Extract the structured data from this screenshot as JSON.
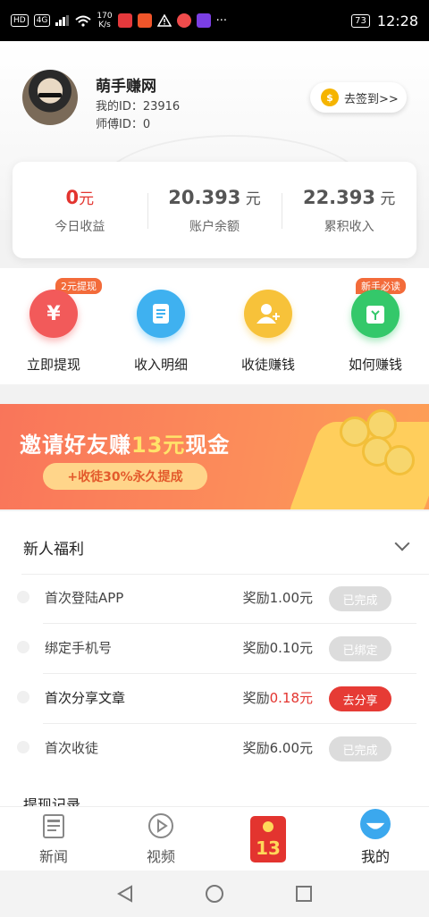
{
  "status_bar": {
    "network_hd": "HD",
    "network_4g": "4G",
    "speed_value": "170",
    "speed_unit": "K/s",
    "more": "···",
    "battery": "73",
    "time": "12:28"
  },
  "profile": {
    "name": "萌手赚网",
    "my_id": "我的ID：23916",
    "master_id": "师傅ID：0",
    "checkin_label": "去签到>>"
  },
  "stats": [
    {
      "value": "0",
      "unit": "元",
      "label": "今日收益"
    },
    {
      "value": "20.393",
      "unit": " 元",
      "label": "账户余额"
    },
    {
      "value": "22.393",
      "unit": " 元",
      "label": "累积收入"
    }
  ],
  "actions": [
    {
      "label": "立即提现",
      "tag": "2元提现",
      "color": "#f25a5a"
    },
    {
      "label": "收入明细",
      "tag": "",
      "color": "#3fb1f0"
    },
    {
      "label": "收徒赚钱",
      "tag": "",
      "color": "#f7c23a"
    },
    {
      "label": "如何赚钱",
      "tag": "新手必读",
      "color": "#34c86a"
    }
  ],
  "banner": {
    "title_pre": "邀请好友赚",
    "title_hl": "13元",
    "title_post": "现金",
    "pill": "+收徒30%永久提成"
  },
  "welfare": {
    "title": "新人福利",
    "rows": [
      {
        "title": "首次登陆APP",
        "reward_pre": "奖励",
        "reward_val": "1.00元",
        "button": "已完成",
        "highlight": false
      },
      {
        "title": "绑定手机号",
        "reward_pre": "奖励",
        "reward_val": "0.10元",
        "button": "已绑定",
        "highlight": false
      },
      {
        "title": "首次分享文章",
        "reward_pre": "奖励",
        "reward_val": "0.18元",
        "button": "去分享",
        "highlight": true
      },
      {
        "title": "首次收徒",
        "reward_pre": "奖励",
        "reward_val": "6.00元",
        "button": "已完成",
        "highlight": false
      }
    ],
    "next_section_peek": "提现记录"
  },
  "tabs": [
    {
      "label": "新闻",
      "icon": "news-icon"
    },
    {
      "label": "视频",
      "icon": "video-icon"
    },
    {
      "label": "13",
      "icon": "red-packet-icon"
    },
    {
      "label": "我的",
      "icon": "profile-icon"
    }
  ],
  "colors": {
    "accent_red": "#e3342f",
    "banner_orange": "#fc8e5a"
  }
}
